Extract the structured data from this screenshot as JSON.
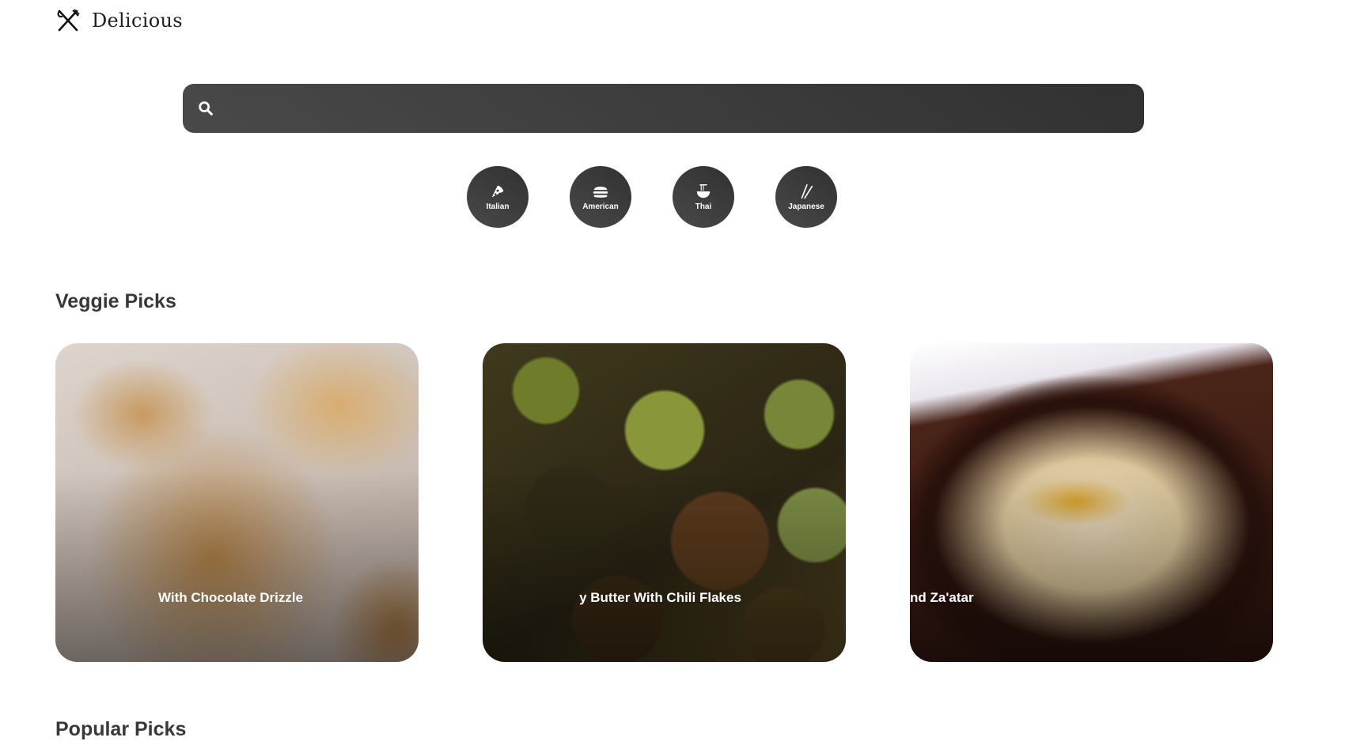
{
  "app": {
    "logo_text": "Delicious",
    "logo_icon": "fork-knife-icon"
  },
  "search": {
    "icon": "search-icon",
    "value": "",
    "placeholder": ""
  },
  "cuisines": [
    {
      "label": "Italian",
      "icon": "pizza-icon"
    },
    {
      "label": "American",
      "icon": "burger-icon"
    },
    {
      "label": "Thai",
      "icon": "noodle-bowl-icon"
    },
    {
      "label": "Japanese",
      "icon": "chopsticks-icon"
    }
  ],
  "veggie": {
    "title": "Veggie Picks",
    "cards": [
      {
        "title": "With Chocolate Drizzle"
      },
      {
        "title": "y Butter With Chili Flakes"
      },
      {
        "title": "nd Za'atar"
      }
    ]
  },
  "popular": {
    "title": "Popular Picks"
  },
  "colors": {
    "chip_bg": "#3a3a3a",
    "search_bg": "#3d3d3d",
    "text_dark": "#383838"
  }
}
